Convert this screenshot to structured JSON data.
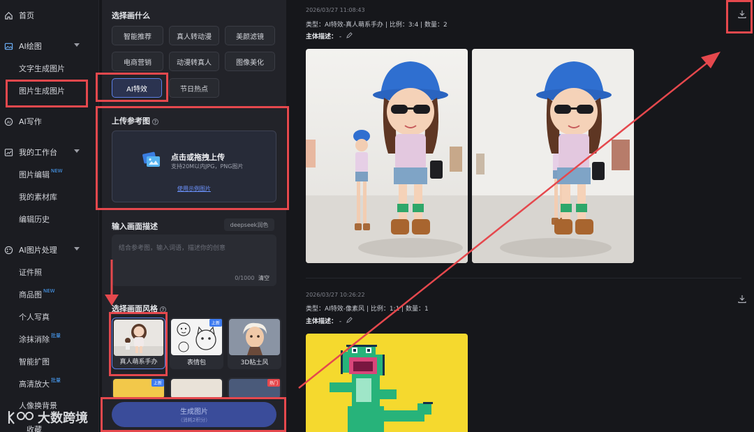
{
  "sidebar": {
    "home": "首页",
    "ai_draw": "AI绘图",
    "text_to_image": "文字生成图片",
    "image_to_image": "图片生成图片",
    "ai_write": "AI写作",
    "workspace": "我的工作台",
    "image_edit": "图片编辑",
    "image_edit_badge": "NEW",
    "materials": "我的素材库",
    "history": "编辑历史",
    "ai_image_process": "AI图片处理",
    "id_photo": "证件照",
    "product_image": "商品图",
    "product_image_badge": "NEW",
    "portrait": "个人写真",
    "erase": "涂抹消除",
    "erase_badge": "批量",
    "smart_expand": "智能扩图",
    "hd_upscale": "高清放大",
    "hd_upscale_badge": "批量",
    "portrait_bg": "人像换背景",
    "collect": "收藏"
  },
  "panel": {
    "choose_title": "选择画什么",
    "chips": [
      "智能推荐",
      "真人转动漫",
      "美颜滤镜",
      "电商营销",
      "动漫转真人",
      "图像美化",
      "AI特效",
      "节日热点"
    ],
    "upload_title": "上传参考图",
    "upload_main": "点击或拖拽上传",
    "upload_sub": "支持20M以内JPG，PNG图片",
    "upload_link": "使用示例图片",
    "desc_title": "输入画面描述",
    "deepseek": "deepseek润色",
    "desc_placeholder": "结合参考图，输入词语，描述你的创意",
    "desc_count": "0/1000",
    "desc_clear": "清空",
    "style_title": "选择画面风格",
    "styles": [
      {
        "label": "真人萌系手办",
        "tag": ""
      },
      {
        "label": "表情包",
        "tag": "上新"
      },
      {
        "label": "3D粘土风",
        "tag": ""
      }
    ],
    "styles_row2_tags": [
      "上新",
      "热门"
    ],
    "generate": "生成图片",
    "generate_sub": "（消耗2积分）"
  },
  "results": [
    {
      "timestamp": "2026/03/27 11:08:43",
      "type_line": "类型：AI特效-真人萌系手办 | 比例：3:4 | 数量：2",
      "subject_label": "主体描述：",
      "subject_value": "-"
    },
    {
      "timestamp": "2026/03/27 10:26:22",
      "type_line": "类型：AI特效-像素风 | 比例：1:1 | 数量：1",
      "subject_label": "主体描述：",
      "subject_value": "-"
    }
  ],
  "watermark": "大数跨境",
  "colors": {
    "highlight": "#e5484d",
    "accent": "#5b7fe6",
    "link": "#6c93ff"
  }
}
